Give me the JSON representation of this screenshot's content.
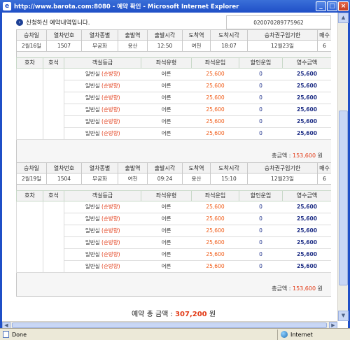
{
  "window": {
    "title": "http://www.barota.com:8080 - 예약 확인 - Microsoft Internet Explorer",
    "icon": "ie-icon"
  },
  "notice": "신청하신 예약내역입니다.",
  "ticket_no": "020070289775962",
  "main_headers": [
    "승차일",
    "열차번호",
    "열차종별",
    "출발역",
    "출발시각",
    "도착역",
    "도착시각",
    "승차권구입기한",
    "매수"
  ],
  "sub_headers": [
    "호차",
    "호석",
    "객실등급",
    "좌석유형",
    "좌석운임",
    "할인운임",
    "영수금액"
  ],
  "trips": [
    {
      "date": "2월16일",
      "train_no": "1507",
      "type": "무궁화",
      "dep_station": "용산",
      "dep_time": "12:50",
      "arr_station": "여천",
      "arr_time": "18:07",
      "deadline": "12월23일",
      "count": "6",
      "rows": [
        {
          "class": "일반실",
          "note": "(순방향)",
          "seat": "어른",
          "fare": "25,600",
          "discount": "0",
          "paid": "25,600"
        },
        {
          "class": "일반실",
          "note": "(순방향)",
          "seat": "어른",
          "fare": "25,600",
          "discount": "0",
          "paid": "25,600"
        },
        {
          "class": "일반실",
          "note": "(순방향)",
          "seat": "어른",
          "fare": "25,600",
          "discount": "0",
          "paid": "25,600"
        },
        {
          "class": "일반실",
          "note": "(순방향)",
          "seat": "어른",
          "fare": "25,600",
          "discount": "0",
          "paid": "25,600"
        },
        {
          "class": "일반실",
          "note": "(순방향)",
          "seat": "어른",
          "fare": "25,600",
          "discount": "0",
          "paid": "25,600"
        },
        {
          "class": "일반실",
          "note": "(순방향)",
          "seat": "어른",
          "fare": "25,600",
          "discount": "0",
          "paid": "25,600"
        }
      ],
      "total_label": "총금액 :",
      "total_amount": "153,600",
      "total_unit": "원"
    },
    {
      "date": "2월19일",
      "train_no": "1504",
      "type": "무궁화",
      "dep_station": "여천",
      "dep_time": "09:24",
      "arr_station": "용산",
      "arr_time": "15:10",
      "deadline": "12월23일",
      "count": "6",
      "rows": [
        {
          "class": "일반실",
          "note": "(순방향)",
          "seat": "어른",
          "fare": "25,600",
          "discount": "0",
          "paid": "25,600"
        },
        {
          "class": "일반실",
          "note": "(순방향)",
          "seat": "어른",
          "fare": "25,600",
          "discount": "0",
          "paid": "25,600"
        },
        {
          "class": "일반실",
          "note": "(순방향)",
          "seat": "어른",
          "fare": "25,600",
          "discount": "0",
          "paid": "25,600"
        },
        {
          "class": "일반실",
          "note": "(순방향)",
          "seat": "어른",
          "fare": "25,600",
          "discount": "0",
          "paid": "25,600"
        },
        {
          "class": "일반실",
          "note": "(순방향)",
          "seat": "어른",
          "fare": "25,600",
          "discount": "0",
          "paid": "25,600"
        },
        {
          "class": "일반실",
          "note": "(순방향)",
          "seat": "어른",
          "fare": "25,600",
          "discount": "0",
          "paid": "25,600"
        }
      ],
      "total_label": "총금액 :",
      "total_amount": "153,600",
      "total_unit": "원"
    }
  ],
  "grand_total": {
    "label": "예약 총 금액 :",
    "amount": "307,200",
    "unit": "원"
  },
  "status": {
    "left": "Done",
    "zone": "Internet"
  },
  "colors": {
    "titlebar": "#1f4fc7",
    "red": "#e23a16",
    "navy": "#1f2f86"
  }
}
